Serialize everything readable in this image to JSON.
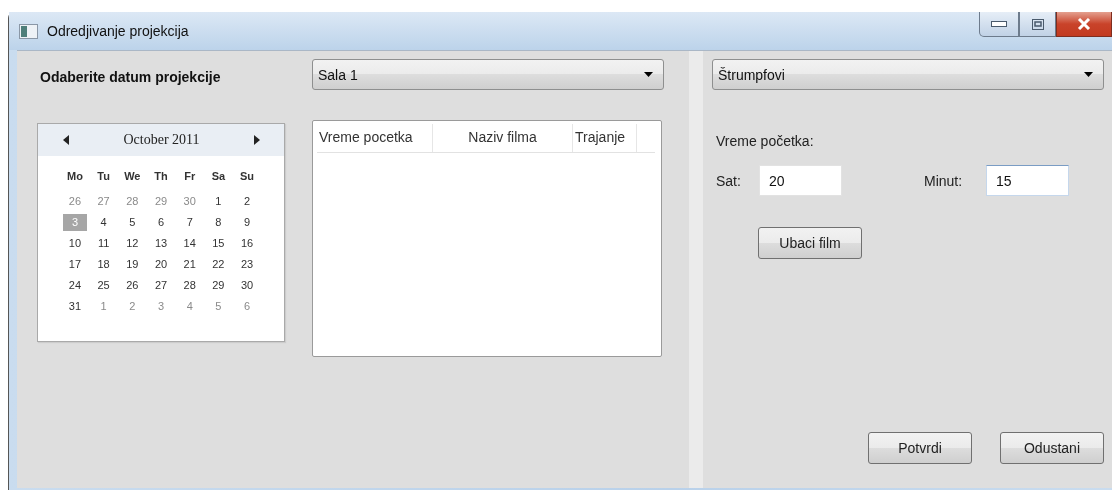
{
  "window": {
    "title": "Odredjivanje projekcija"
  },
  "left_panel": {
    "date_heading": "Odaberite datum projekcije",
    "hall_select": {
      "value": "Sala 1"
    },
    "calendar": {
      "month": "October 2011",
      "weekdays": [
        "Mo",
        "Tu",
        "We",
        "Th",
        "Fr",
        "Sa",
        "Su"
      ],
      "days": [
        {
          "text": "26",
          "other_month": true,
          "selected": false
        },
        {
          "text": "27",
          "other_month": true,
          "selected": false
        },
        {
          "text": "28",
          "other_month": true,
          "selected": false
        },
        {
          "text": "29",
          "other_month": true,
          "selected": false
        },
        {
          "text": "30",
          "other_month": true,
          "selected": false
        },
        {
          "text": "1",
          "other_month": false,
          "selected": false
        },
        {
          "text": "2",
          "other_month": false,
          "selected": false
        },
        {
          "text": "3",
          "other_month": false,
          "selected": true
        },
        {
          "text": "4",
          "other_month": false,
          "selected": false
        },
        {
          "text": "5",
          "other_month": false,
          "selected": false
        },
        {
          "text": "6",
          "other_month": false,
          "selected": false
        },
        {
          "text": "7",
          "other_month": false,
          "selected": false
        },
        {
          "text": "8",
          "other_month": false,
          "selected": false
        },
        {
          "text": "9",
          "other_month": false,
          "selected": false
        },
        {
          "text": "10",
          "other_month": false,
          "selected": false
        },
        {
          "text": "11",
          "other_month": false,
          "selected": false
        },
        {
          "text": "12",
          "other_month": false,
          "selected": false
        },
        {
          "text": "13",
          "other_month": false,
          "selected": false
        },
        {
          "text": "14",
          "other_month": false,
          "selected": false
        },
        {
          "text": "15",
          "other_month": false,
          "selected": false
        },
        {
          "text": "16",
          "other_month": false,
          "selected": false
        },
        {
          "text": "17",
          "other_month": false,
          "selected": false
        },
        {
          "text": "18",
          "other_month": false,
          "selected": false
        },
        {
          "text": "19",
          "other_month": false,
          "selected": false
        },
        {
          "text": "20",
          "other_month": false,
          "selected": false
        },
        {
          "text": "21",
          "other_month": false,
          "selected": false
        },
        {
          "text": "22",
          "other_month": false,
          "selected": false
        },
        {
          "text": "23",
          "other_month": false,
          "selected": false
        },
        {
          "text": "24",
          "other_month": false,
          "selected": false
        },
        {
          "text": "25",
          "other_month": false,
          "selected": false
        },
        {
          "text": "26",
          "other_month": false,
          "selected": false
        },
        {
          "text": "27",
          "other_month": false,
          "selected": false
        },
        {
          "text": "28",
          "other_month": false,
          "selected": false
        },
        {
          "text": "29",
          "other_month": false,
          "selected": false
        },
        {
          "text": "30",
          "other_month": false,
          "selected": false
        },
        {
          "text": "31",
          "other_month": false,
          "selected": false
        },
        {
          "text": "1",
          "other_month": true,
          "selected": false
        },
        {
          "text": "2",
          "other_month": true,
          "selected": false
        },
        {
          "text": "3",
          "other_month": true,
          "selected": false
        },
        {
          "text": "4",
          "other_month": true,
          "selected": false
        },
        {
          "text": "5",
          "other_month": true,
          "selected": false
        },
        {
          "text": "6",
          "other_month": true,
          "selected": false
        }
      ]
    },
    "table": {
      "columns": [
        "Vreme pocetka",
        "Naziv filma",
        "Trajanje"
      ]
    }
  },
  "right_panel": {
    "movie_select": {
      "value": "Štrumpfovi"
    },
    "start_time_label": "Vreme početka:",
    "hour": {
      "label": "Sat:",
      "value": "20",
      "focused": false
    },
    "minute": {
      "label": "Minut:",
      "value": "15",
      "focused": true
    },
    "insert_button": "Ubaci film"
  },
  "buttons": [
    "Potvrdi",
    "Odustani"
  ]
}
